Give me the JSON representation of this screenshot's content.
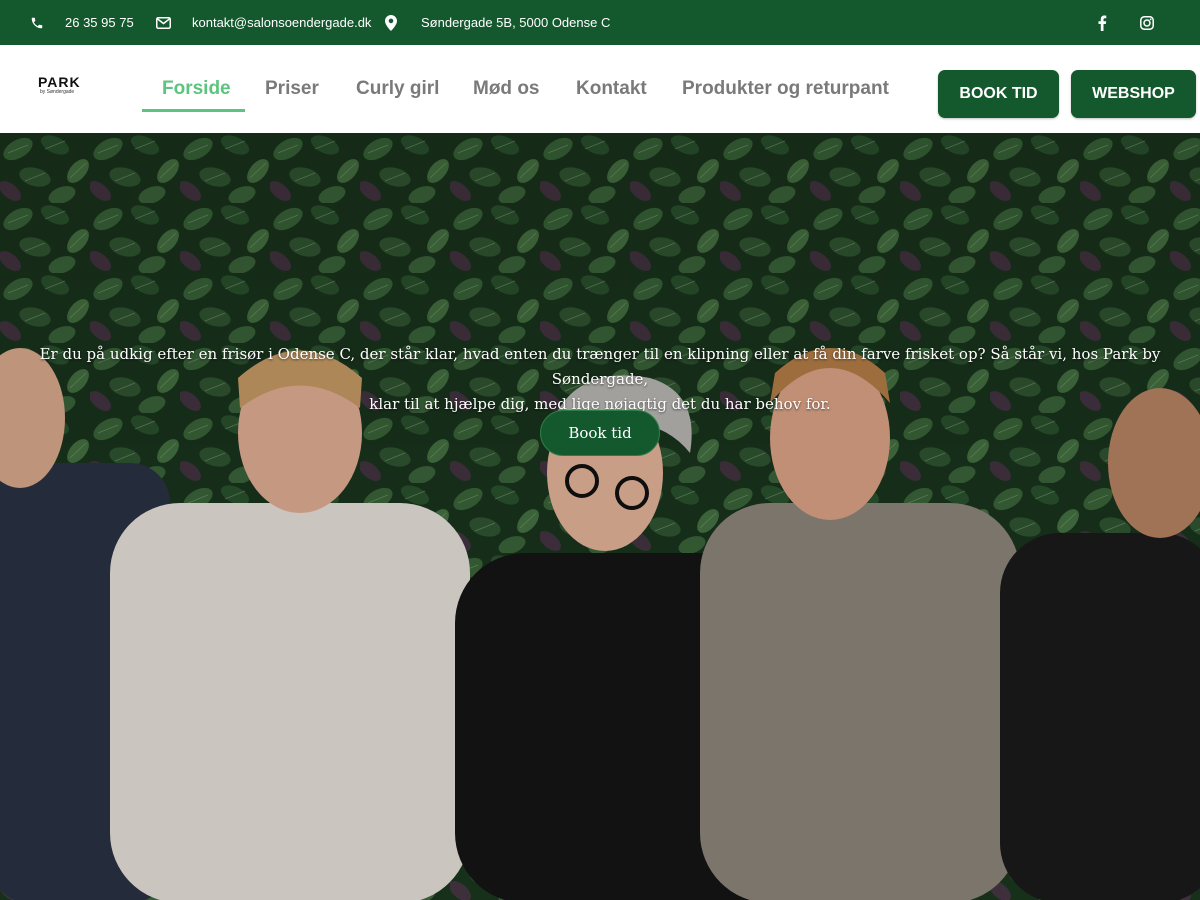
{
  "topbar": {
    "phone": "26 35 95 75",
    "email": "kontakt@salonsoendergade.dk",
    "address": "Søndergade 5B, 5000 Odense C",
    "icons": [
      "phone-icon",
      "envelope-icon",
      "map-pin-icon",
      "facebook-icon",
      "instagram-icon"
    ]
  },
  "logo": {
    "name": "PARK",
    "tagline": "by Søndergade"
  },
  "nav": {
    "items": [
      {
        "label": "Forside",
        "active": true
      },
      {
        "label": "Priser",
        "active": false
      },
      {
        "label": "Curly girl",
        "active": false
      },
      {
        "label": "Mød os",
        "active": false
      },
      {
        "label": "Kontakt",
        "active": false
      },
      {
        "label": "Produkter og returpant",
        "active": false
      }
    ]
  },
  "buttons": {
    "book": "BOOK TID",
    "webshop": "WEBSHOP"
  },
  "hero": {
    "intro_line1": "Er du på udkig efter en frisør i Odense C, der står klar, hvad enten du trænger til en klipning eller at få din farve frisket op? Så står vi, hos Park by Søndergade,",
    "intro_line2": "klar til at hjælpe dig, med lige nøjagtig det du har behov for.",
    "cta": "Book tid"
  },
  "colors": {
    "brand_green": "#14582e",
    "active_nav": "#5cc47f",
    "nav_text": "#7a7a7a"
  }
}
